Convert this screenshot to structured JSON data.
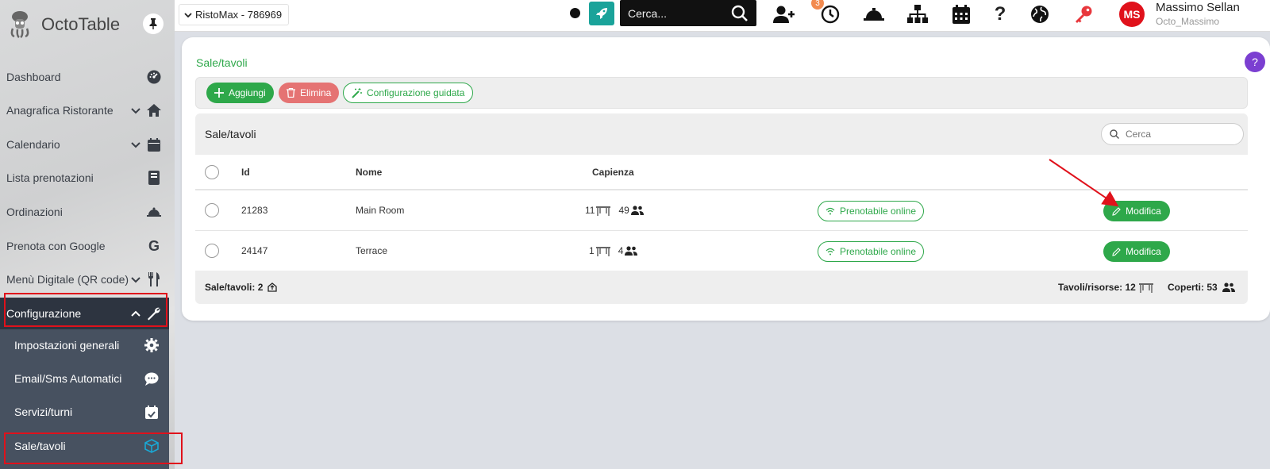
{
  "sidebar": {
    "brand": "OctoTable",
    "items": [
      {
        "label": "Dashboard",
        "icon": "dashboard-gauge-icon",
        "chevron": false
      },
      {
        "label": "Anagrafica Ristorante",
        "icon": "home-icon",
        "chevron": true
      },
      {
        "label": "Calendario",
        "icon": "calendar-icon",
        "chevron": true
      },
      {
        "label": "Lista prenotazioni",
        "icon": "book-icon",
        "chevron": false
      },
      {
        "label": "Ordinazioni",
        "icon": "cloche-icon",
        "chevron": false
      },
      {
        "label": "Prenota con Google",
        "icon": "google-icon",
        "chevron": false
      },
      {
        "label": "Menù Digitale (QR code)",
        "icon": "utensils-icon",
        "chevron": true
      },
      {
        "label": "Configurazione",
        "icon": "wrench-icon",
        "chevron": true
      }
    ],
    "subitems": [
      {
        "label": "Impostazioni generali",
        "icon": "gear-icon"
      },
      {
        "label": "Email/Sms Automatici",
        "icon": "chat-bubble-icon"
      },
      {
        "label": "Servizi/turni",
        "icon": "calendar-check-icon"
      },
      {
        "label": "Sale/tavoli",
        "icon": "cube-icon"
      }
    ]
  },
  "topbar": {
    "restaurant": "RistoMax - 786969",
    "search_placeholder": "Cerca...",
    "notification_count": "3",
    "user_initials": "MS",
    "user_name": "Massimo Sellan",
    "user_handle": "Octo_Massimo"
  },
  "page": {
    "title": "Sale/tavoli",
    "help": "?",
    "toolbar": {
      "add": "Aggiungi",
      "delete": "Elimina",
      "wizard": "Configurazione guidata"
    },
    "table": {
      "title": "Sale/tavoli",
      "search_placeholder": "Cerca",
      "columns": {
        "id": "Id",
        "name": "Nome",
        "capacity": "Capienza"
      },
      "rows": [
        {
          "id": "21283",
          "name": "Main Room",
          "tables": "11",
          "seats": "49",
          "online": "Prenotabile online",
          "edit": "Modifica"
        },
        {
          "id": "24147",
          "name": "Terrace",
          "tables": "1",
          "seats": "4",
          "online": "Prenotabile online",
          "edit": "Modifica"
        }
      ],
      "footer": {
        "rooms": "Sale/tavoli: 2",
        "tables": "Tavoli/risorse: 12",
        "covers": "Coperti: 53"
      }
    }
  },
  "colors": {
    "green": "#2ea84a",
    "red_highlight": "#e0111b",
    "teal": "#1aa39a",
    "purple": "#7b3fd1"
  }
}
